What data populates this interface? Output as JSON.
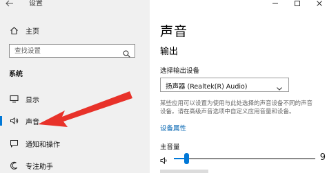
{
  "window": {
    "title": "设置"
  },
  "sidebar": {
    "home_label": "主页",
    "search_placeholder": "查找设置",
    "section_label": "系统",
    "items": [
      {
        "label": "显示",
        "icon": "monitor-icon"
      },
      {
        "label": "声音",
        "icon": "speaker-icon",
        "active": true
      },
      {
        "label": "通知和操作",
        "icon": "notification-icon"
      },
      {
        "label": "专注助手",
        "icon": "focus-assist-icon"
      }
    ]
  },
  "main": {
    "title": "声音",
    "output_heading": "输出",
    "select_output_label": "选择输出设备",
    "output_device": "扬声器 (Realtek(R) Audio)",
    "description_lines": [
      "某些应用可以设置为使用与此处选择的声音设备不同的声音",
      "设备。请在高级声音选项中自定义应用音量和设备。"
    ],
    "device_properties_link": "设备属性",
    "master_volume_label": "主音量",
    "volume_value": "9",
    "volume_level": 9
  },
  "colors": {
    "accent": "#0078d7",
    "link": "#0063b1",
    "annotation_arrow": "#e8322a"
  }
}
